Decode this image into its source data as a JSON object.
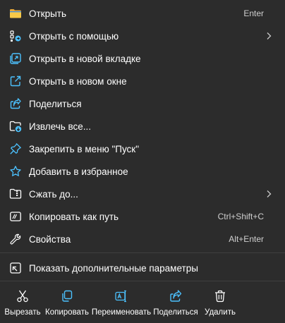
{
  "colors": {
    "background": "#2c2c2c",
    "text": "#ffffff",
    "shortcut_text": "#cfcfcf",
    "accent_blue": "#4cc2ff",
    "folder_yellow": "#f5c04a"
  },
  "menu_items": [
    {
      "label": "Открыть",
      "shortcut": "Enter",
      "icon": "folder-open-icon"
    },
    {
      "label": "Открыть с помощью",
      "shortcut": "",
      "icon": "open-with-icon",
      "submenu": true
    },
    {
      "label": "Открыть в новой вкладке",
      "shortcut": "",
      "icon": "new-tab-icon"
    },
    {
      "label": "Открыть в новом окне",
      "shortcut": "",
      "icon": "new-window-icon"
    },
    {
      "label": "Поделиться",
      "shortcut": "",
      "icon": "share-icon"
    },
    {
      "label": "Извлечь все...",
      "shortcut": "",
      "icon": "extract-all-icon"
    },
    {
      "label": "Закрепить в меню \"Пуск\"",
      "shortcut": "",
      "icon": "pin-icon"
    },
    {
      "label": "Добавить в избранное",
      "shortcut": "",
      "icon": "star-icon"
    },
    {
      "label": "Сжать до...",
      "shortcut": "",
      "icon": "compress-folder-icon",
      "submenu": true
    },
    {
      "label": "Копировать как путь",
      "shortcut": "Ctrl+Shift+C",
      "icon": "copy-path-icon"
    },
    {
      "label": "Свойства",
      "shortcut": "Alt+Enter",
      "icon": "wrench-icon"
    },
    {
      "label": "Показать дополнительные параметры",
      "shortcut": "",
      "icon": "more-options-icon"
    }
  ],
  "toolbar": {
    "cut_label": "Вырезать",
    "copy_label": "Копировать",
    "rename_label": "Переименовать",
    "share_label": "Поделиться",
    "delete_label": "Удалить"
  }
}
